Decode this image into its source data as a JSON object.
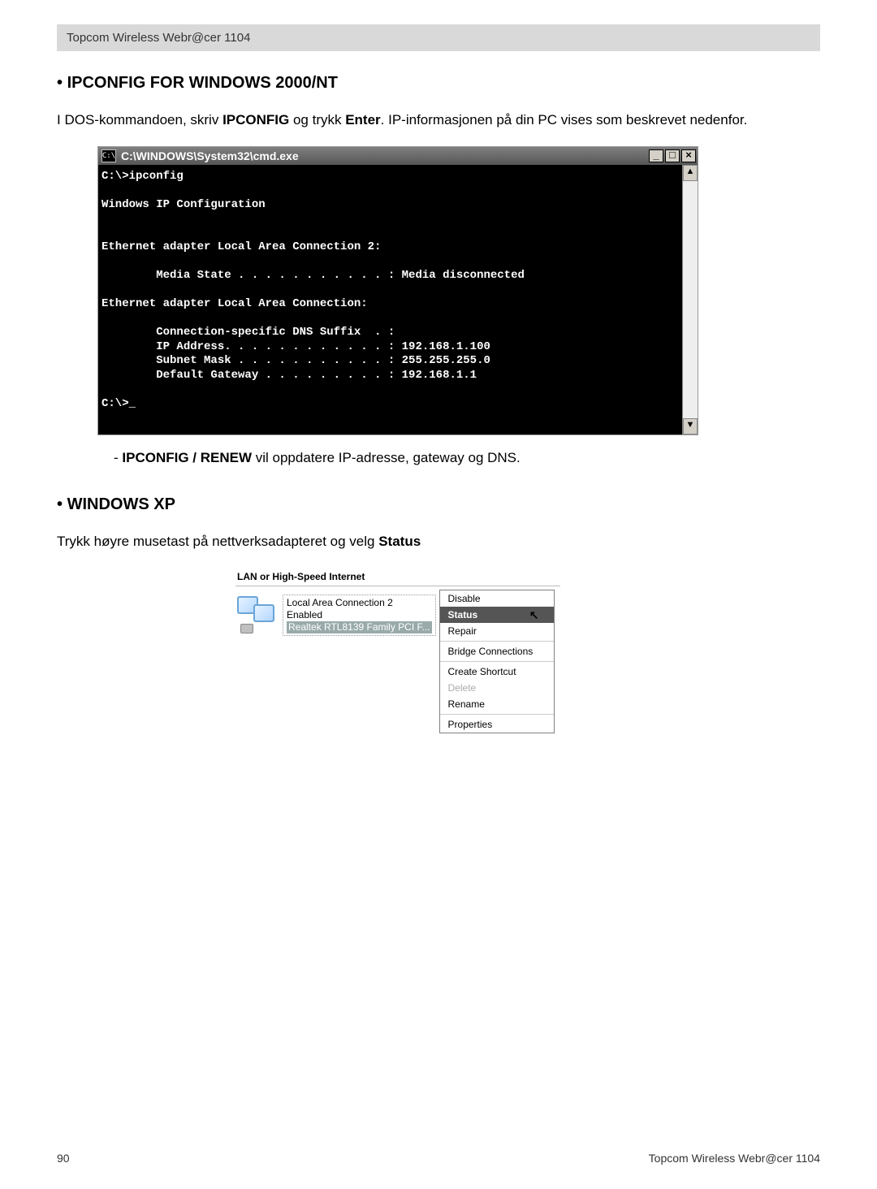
{
  "header": "Topcom Wireless Webr@cer 1104",
  "section1": {
    "bullet": "•",
    "title": "IPCONFIG FOR WINDOWS 2000/NT",
    "intro_pre": "I DOS-kommandoen, skriv ",
    "intro_b1": "IPCONFIG",
    "intro_mid": " og trykk ",
    "intro_b2": "Enter",
    "intro_post": ". IP-informasjonen på din PC vises som beskrevet nedenfor."
  },
  "cmd": {
    "icon_text": "C:\\",
    "title": "C:\\WINDOWS\\System32\\cmd.exe",
    "btn_min": "_",
    "btn_max": "□",
    "btn_close": "×",
    "scroll_up": "▲",
    "scroll_down": "▼",
    "lines": "C:\\>ipconfig\n\nWindows IP Configuration\n\n\nEthernet adapter Local Area Connection 2:\n\n        Media State . . . . . . . . . . . : Media disconnected\n\nEthernet adapter Local Area Connection:\n\n        Connection-specific DNS Suffix  . :\n        IP Address. . . . . . . . . . . . : 192.168.1.100\n        Subnet Mask . . . . . . . . . . . : 255.255.255.0\n        Default Gateway . . . . . . . . . : 192.168.1.1\n\nC:\\>_"
  },
  "note": {
    "dash": "- ",
    "bold": "IPCONFIG / RENEW",
    "rest": " vil oppdatere IP-adresse, gateway og DNS."
  },
  "section2": {
    "bullet": "•",
    "title": "WINDOWS XP",
    "intro_pre": "Trykk høyre musetast på nettverksadapteret og velg ",
    "intro_b1": "Status"
  },
  "xp": {
    "header": "LAN or High-Speed Internet",
    "conn_name": "Local Area Connection 2",
    "conn_state": "Enabled",
    "conn_device": "Realtek RTL8139 Family PCI F...",
    "menu": {
      "disable": "Disable",
      "status": "Status",
      "repair": "Repair",
      "bridge": "Bridge Connections",
      "shortcut": "Create Shortcut",
      "delete": "Delete",
      "rename": "Rename",
      "properties": "Properties"
    },
    "cursor": "↖"
  },
  "footer": {
    "page": "90",
    "brand": "Topcom Wireless Webr@cer 1104"
  }
}
